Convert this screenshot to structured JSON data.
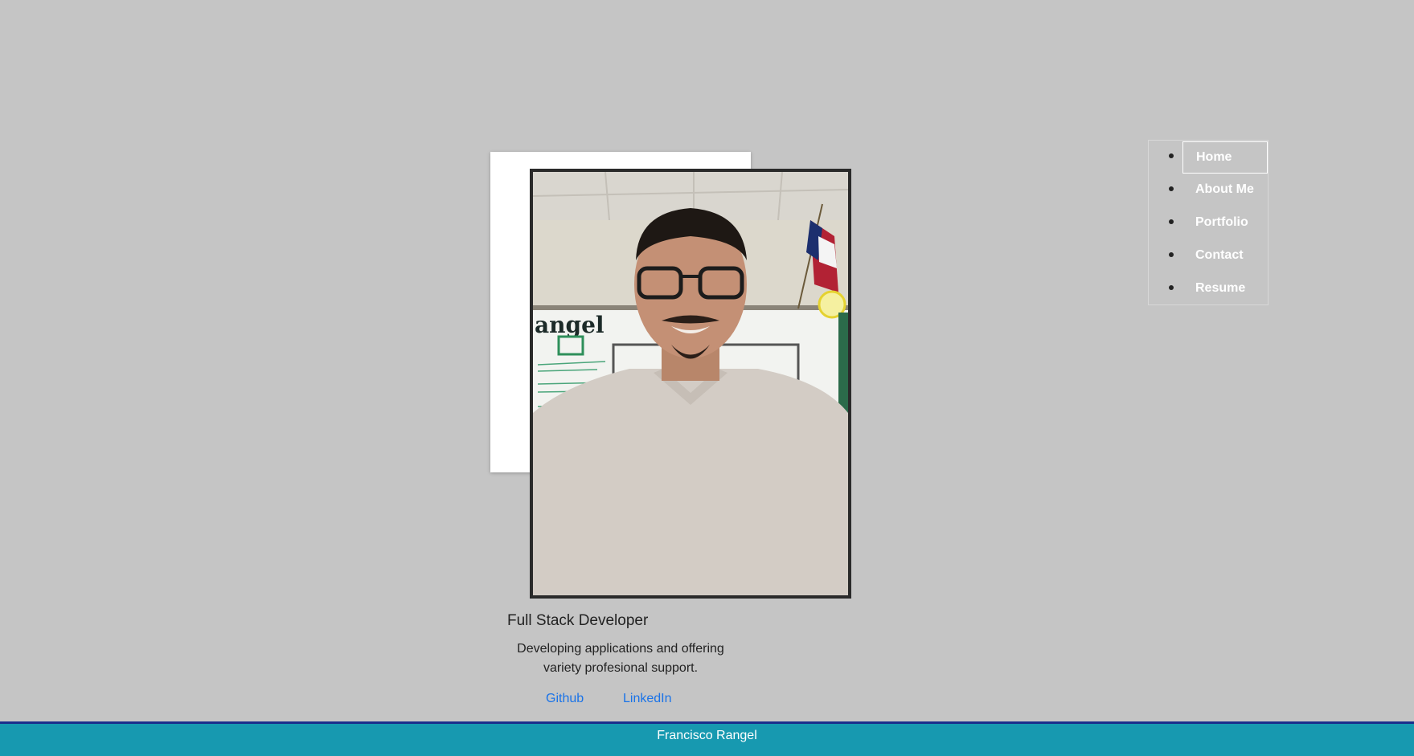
{
  "nav": {
    "items": [
      {
        "label": "Home",
        "active": true
      },
      {
        "label": "About Me",
        "active": false
      },
      {
        "label": "Portfolio",
        "active": false
      },
      {
        "label": "Contact",
        "active": false
      },
      {
        "label": "Resume",
        "active": false
      }
    ]
  },
  "profile": {
    "title": "Full Stack Developer",
    "description": "Developing applications and offering variety profesional support.",
    "links": {
      "github": "Github",
      "linkedin": "LinkedIn"
    }
  },
  "footer": {
    "name": "Francisco Rangel"
  },
  "colors": {
    "background": "#c5c5c5",
    "footer": "#1799b0",
    "footer_border": "#1a2e8c",
    "link": "#1a73e8"
  }
}
